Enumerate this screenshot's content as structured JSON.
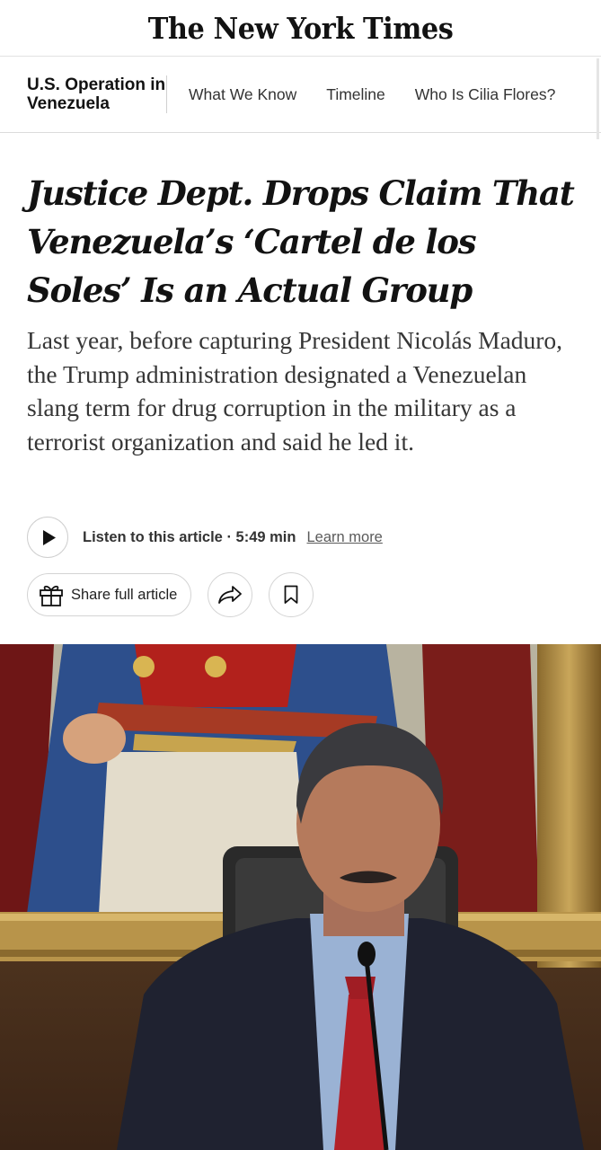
{
  "masthead": {
    "title": "The New York Times"
  },
  "section": {
    "label": "U.S. Operation in Venezuela",
    "links": [
      "What We Know",
      "Timeline",
      "Who Is Cilia Flores?"
    ]
  },
  "article": {
    "headline": "Justice Dept. Drops Claim That Venezuela’s ‘Cartel de los Soles’ Is an Actual Group",
    "summary": "Last year, before capturing President Nicolás Maduro, the Trump administration designated a Venezuelan slang term for drug corruption in the military as a terrorist organization and said he led it."
  },
  "audio": {
    "listen_label": "Listen to this article · 5:49 min",
    "learn_more": "Learn more"
  },
  "share": {
    "label": "Share full article"
  },
  "icons": {
    "play": "play-icon",
    "gift": "gift-icon",
    "share": "share-arrow-icon",
    "bookmark": "bookmark-icon"
  },
  "colors": {
    "text": "#121212",
    "muted": "#363636",
    "border": "#d4d4d4"
  }
}
